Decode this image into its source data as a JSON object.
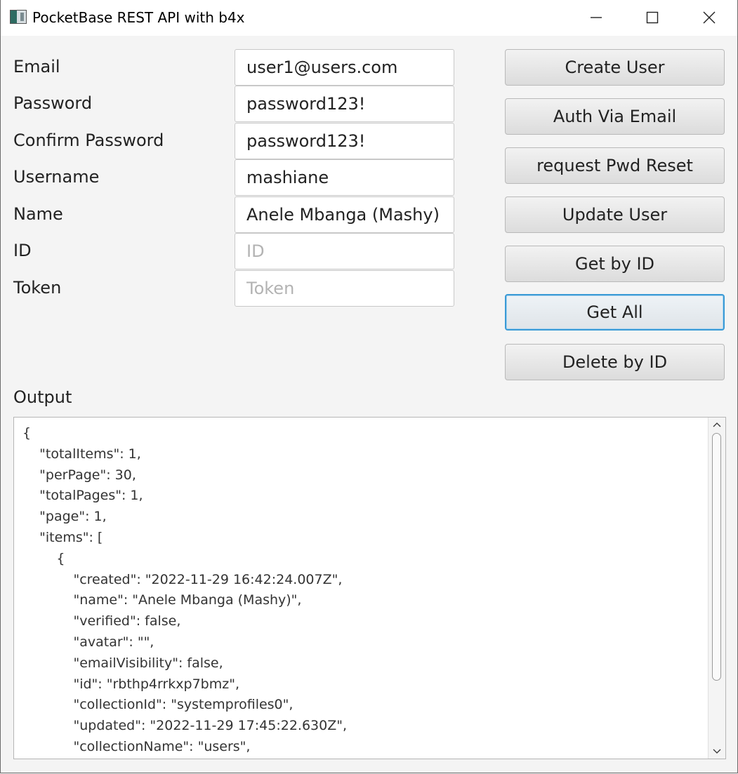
{
  "window": {
    "title": "PocketBase REST API with b4x",
    "app_icon": "b4x-app-icon",
    "controls": [
      "minimize-icon",
      "maximize-icon",
      "close-icon"
    ]
  },
  "form": {
    "email": {
      "label": "Email",
      "value": "user1@users.com",
      "placeholder": ""
    },
    "password": {
      "label": "Password",
      "value": "password123!",
      "placeholder": ""
    },
    "confirm_password": {
      "label": "Confirm Password",
      "value": "password123!",
      "placeholder": ""
    },
    "username": {
      "label": "Username",
      "value": "mashiane",
      "placeholder": ""
    },
    "name": {
      "label": "Name",
      "value": "Anele Mbanga (Mashy)",
      "placeholder": ""
    },
    "id": {
      "label": "ID",
      "value": "",
      "placeholder": "ID"
    },
    "token": {
      "label": "Token",
      "value": "",
      "placeholder": "Token"
    }
  },
  "buttons": {
    "create_user": "Create User",
    "auth_via_email": "Auth Via Email",
    "request_pwd_reset": "request Pwd Reset",
    "update_user": "Update User",
    "get_by_id": "Get by ID",
    "get_all": "Get All",
    "delete_by_id": "Delete by ID"
  },
  "output": {
    "label": "Output",
    "text": "{\n    \"totalItems\": 1,\n    \"perPage\": 30,\n    \"totalPages\": 1,\n    \"page\": 1,\n    \"items\": [\n        {\n            \"created\": \"2022-11-29 16:42:24.007Z\",\n            \"name\": \"Anele Mbanga (Mashy)\",\n            \"verified\": false,\n            \"avatar\": \"\",\n            \"emailVisibility\": false,\n            \"id\": \"rbthp4rrkxp7bmz\",\n            \"collectionId\": \"systemprofiles0\",\n            \"updated\": \"2022-11-29 17:45:22.630Z\",\n            \"collectionName\": \"users\","
  },
  "colors": {
    "focus_ring": "#3a9ad6",
    "window_bg": "#f4f4f4",
    "titlebar_bg": "#ffffff"
  }
}
